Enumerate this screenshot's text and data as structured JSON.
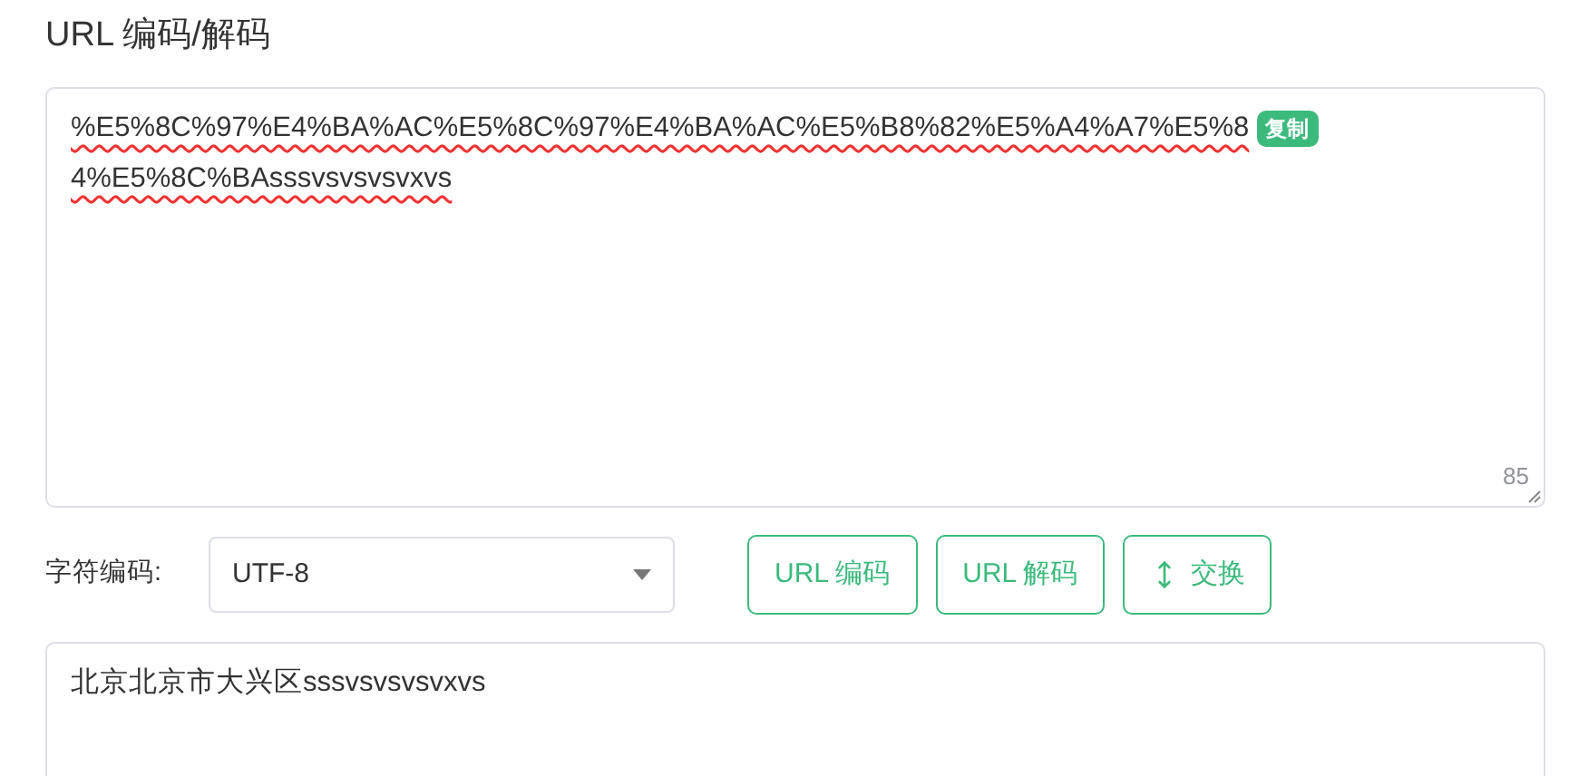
{
  "title": "URL 编码/解码",
  "input": {
    "lines": [
      "%E5%8C%97%E4%BA%AC%E5%8C%97%E4%BA%AC%E5%B8%82%E5%A4%A7%E5%8",
      "4%E5%8C%BAsssvsvsvsvxvs"
    ],
    "copy_badge": "复制",
    "count": "85"
  },
  "charset": {
    "label": "字符编码:",
    "value": "UTF-8"
  },
  "buttons": [
    {
      "label": "URL 编码",
      "kind": "text"
    },
    {
      "label": "URL 解码",
      "kind": "text"
    },
    {
      "label": "交换",
      "kind": "swap"
    }
  ],
  "output": {
    "value": "北京北京市大兴区sssvsvsvsvxvs"
  }
}
